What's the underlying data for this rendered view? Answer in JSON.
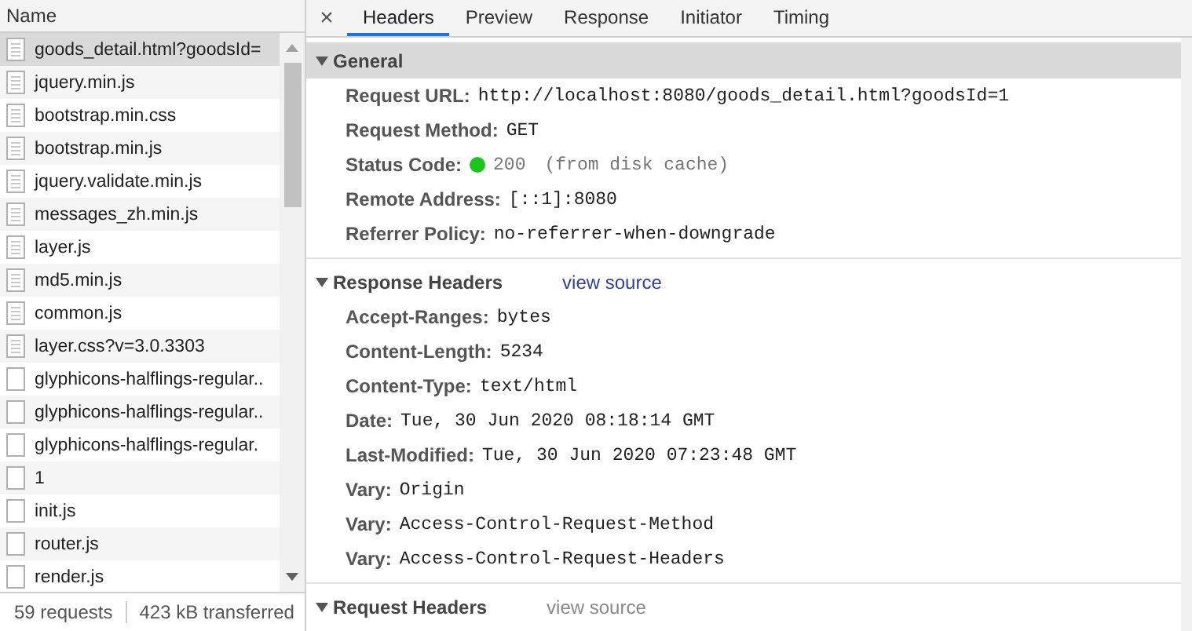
{
  "name_column": {
    "title": "Name"
  },
  "files": [
    {
      "name": "goods_detail.html?goodsId=",
      "kind": "document",
      "selected": true
    },
    {
      "name": "jquery.min.js",
      "kind": "document",
      "selected": false
    },
    {
      "name": "bootstrap.min.css",
      "kind": "document",
      "selected": false
    },
    {
      "name": "bootstrap.min.js",
      "kind": "document",
      "selected": false
    },
    {
      "name": "jquery.validate.min.js",
      "kind": "document",
      "selected": false
    },
    {
      "name": "messages_zh.min.js",
      "kind": "document",
      "selected": false
    },
    {
      "name": "layer.js",
      "kind": "document",
      "selected": false
    },
    {
      "name": "md5.min.js",
      "kind": "document",
      "selected": false
    },
    {
      "name": "common.js",
      "kind": "document",
      "selected": false
    },
    {
      "name": "layer.css?v=3.0.3303",
      "kind": "document",
      "selected": false
    },
    {
      "name": "glyphicons-halflings-regular..",
      "kind": "blank",
      "selected": false
    },
    {
      "name": "glyphicons-halflings-regular..",
      "kind": "blank",
      "selected": false
    },
    {
      "name": "glyphicons-halflings-regular.",
      "kind": "blank",
      "selected": false
    },
    {
      "name": "1",
      "kind": "blank",
      "selected": false
    },
    {
      "name": "init.js",
      "kind": "blank",
      "selected": false
    },
    {
      "name": "router.js",
      "kind": "blank",
      "selected": false
    },
    {
      "name": "render.js",
      "kind": "blank",
      "selected": false
    }
  ],
  "status_bar": {
    "requests": "59 requests",
    "transferred": "423 kB transferred"
  },
  "close": "×",
  "tabs": [
    {
      "label": "Headers",
      "selected": true
    },
    {
      "label": "Preview",
      "selected": false
    },
    {
      "label": "Response",
      "selected": false
    },
    {
      "label": "Initiator",
      "selected": false
    },
    {
      "label": "Timing",
      "selected": false
    }
  ],
  "sections": [
    {
      "title": "General",
      "expanded": true,
      "highlighted": true,
      "rows": [
        {
          "kind": "plain",
          "key": "Request URL:",
          "value": "http://localhost:8080/goods_detail.html?goodsId=1"
        },
        {
          "kind": "plain",
          "key": "Request Method:",
          "value": "GET"
        },
        {
          "kind": "status",
          "key": "Status Code:",
          "color": "#1ec41e",
          "value": "200",
          "note": "(from disk cache)"
        },
        {
          "kind": "plain",
          "key": "Remote Address:",
          "value": "[::1]:8080"
        },
        {
          "kind": "plain",
          "key": "Referrer Policy:",
          "value": "no-referrer-when-downgrade"
        }
      ]
    },
    {
      "title": "Response Headers",
      "expanded": true,
      "highlighted": false,
      "view_source": {
        "label": "view source",
        "disabled": false
      },
      "rows": [
        {
          "kind": "plain",
          "key": "Accept-Ranges:",
          "value": "bytes"
        },
        {
          "kind": "plain",
          "key": "Content-Length:",
          "value": "5234"
        },
        {
          "kind": "plain",
          "key": "Content-Type:",
          "value": "text/html"
        },
        {
          "kind": "plain",
          "key": "Date:",
          "value": "Tue, 30 Jun 2020 08:18:14 GMT"
        },
        {
          "kind": "plain",
          "key": "Last-Modified:",
          "value": "Tue, 30 Jun 2020 07:23:48 GMT"
        },
        {
          "kind": "plain",
          "key": "Vary:",
          "value": "Origin"
        },
        {
          "kind": "plain",
          "key": "Vary:",
          "value": "Access-Control-Request-Method"
        },
        {
          "kind": "plain",
          "key": "Vary:",
          "value": "Access-Control-Request-Headers"
        }
      ]
    },
    {
      "title": "Request Headers",
      "expanded": true,
      "highlighted": false,
      "view_source": {
        "label": "view source",
        "disabled": true
      }
    }
  ]
}
